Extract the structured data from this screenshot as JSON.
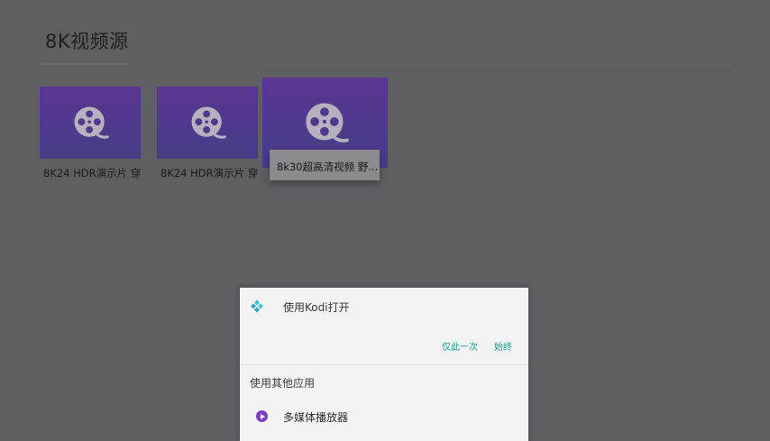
{
  "page": {
    "title": "8K视频源"
  },
  "videos": [
    {
      "caption": "8K24 HDR演示片 穿",
      "focused": false
    },
    {
      "caption": "8K24 HDR演示片 穿",
      "focused": false
    },
    {
      "caption": "8k30超高清视频 野...",
      "focused": true
    }
  ],
  "icons": {
    "thumbnail": "film-reel-icon",
    "kodi": "kodi-logo-icon",
    "media_player": "play-circle-icon"
  },
  "dialog": {
    "title": "使用Kodi打开",
    "once_label": "仅此一次",
    "always_label": "始终",
    "other_apps_label": "使用其他应用",
    "apps": [
      {
        "label": "多媒体播放器"
      }
    ]
  },
  "colors": {
    "background": "#5e5e63",
    "thumbnail_purple": "#5a3690",
    "accent_teal": "#1b9a8e",
    "player_purple": "#7b3fc4"
  }
}
